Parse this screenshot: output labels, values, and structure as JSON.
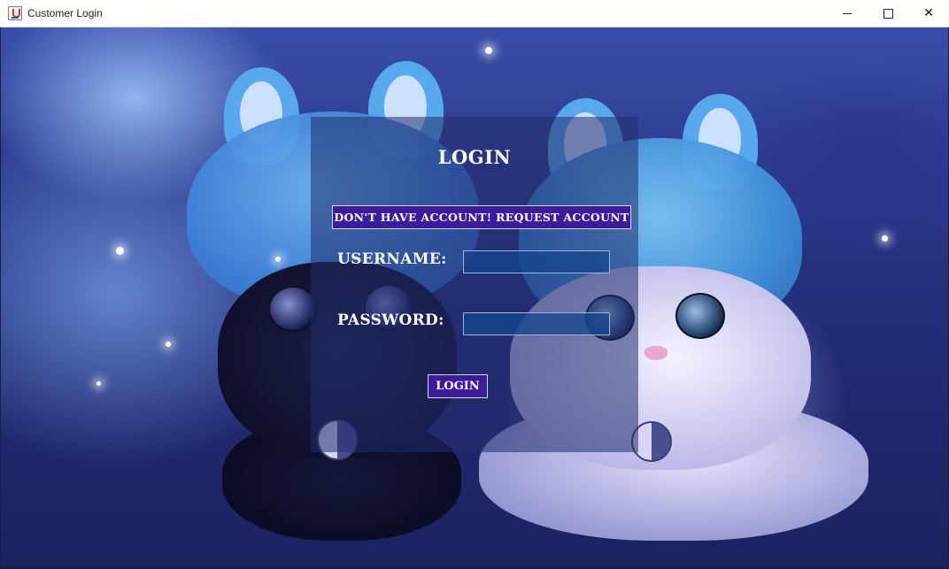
{
  "window": {
    "title": "Customer Login",
    "app_icon": "java-icon",
    "controls": {
      "minimize": "minimize-icon",
      "maximize": "maximize-icon",
      "close": "close-icon"
    }
  },
  "login_form": {
    "heading": "LOGIN",
    "request_account_button": "DON'T HAVE ACCOUNT! REQUEST ACCOUNT",
    "username_label": "USERNAME:",
    "username_value": "",
    "password_label": "PASSWORD:",
    "password_value": "",
    "login_button": "LOGIN"
  },
  "colors": {
    "button_bg": "#3a1c9c",
    "panel_overlay": "rgba(35,45,110,0.55)",
    "input_bg": "#14468c"
  }
}
